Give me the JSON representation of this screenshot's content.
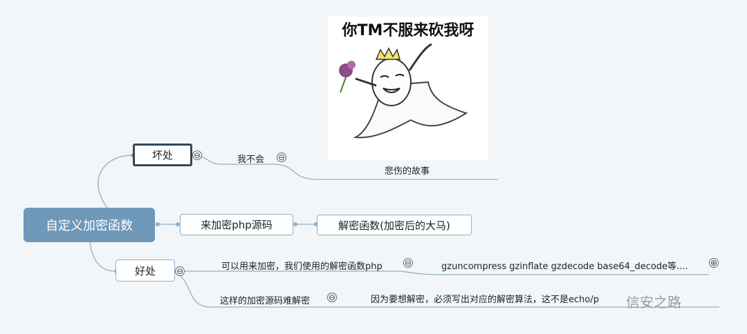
{
  "root": {
    "label": "自定义加密函数"
  },
  "branches": {
    "bad": {
      "label": "坏处",
      "child": {
        "label": "我不会"
      },
      "grandchild": {
        "label": "悲伤的故事"
      },
      "image_caption": "你TM不服来砍我呀"
    },
    "middle": {
      "label": "来加密php源码",
      "child": {
        "label": "解密函数(加密后的大马)"
      }
    },
    "good": {
      "label": "好处",
      "child1": {
        "label": "可以用来加密，我们使用的解密函数php",
        "sub": "gzuncompress gzinflate gzdecode base64_decode等...."
      },
      "child2": {
        "label": "这样的加密源码难解密",
        "sub": "因为要想解密，必须写出对应的解密算法，这不是echo/p"
      }
    }
  },
  "toggles": {
    "collapse": "⊖",
    "expand": "⊕"
  },
  "watermark": {
    "text": "信安之路"
  },
  "colors": {
    "root_fill": "#6f98b9",
    "line": "#8fb0c9",
    "selected_border": "#334756"
  }
}
